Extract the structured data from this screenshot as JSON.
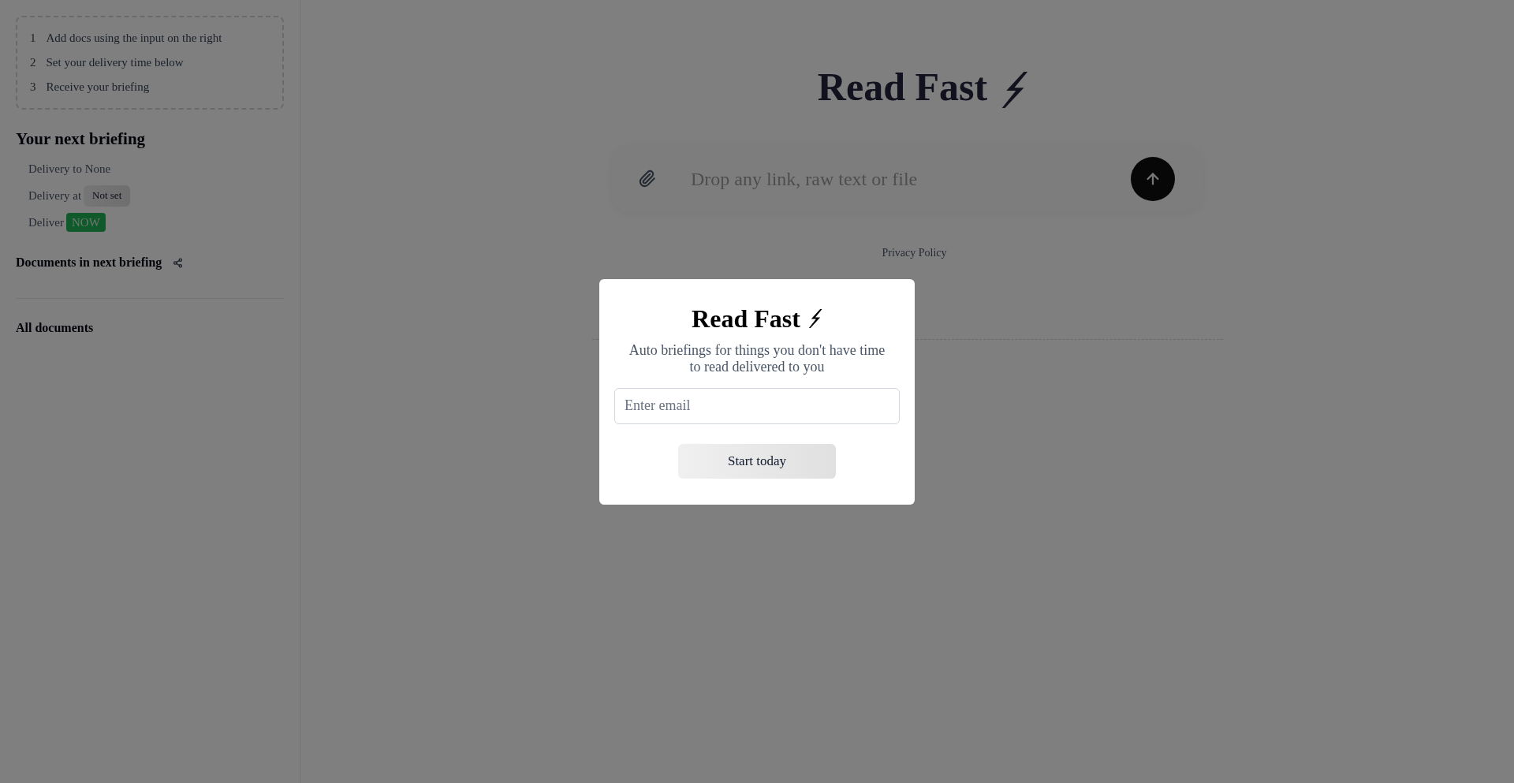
{
  "sidebar": {
    "steps": [
      {
        "number": "1",
        "text": "Add docs using the input on the right"
      },
      {
        "number": "2",
        "text": "Set your delivery time below"
      },
      {
        "number": "3",
        "text": "Receive your briefing"
      }
    ],
    "next_briefing": {
      "title": "Your next briefing",
      "rows": [
        {
          "kind": "text",
          "label": "Delivery to None"
        },
        {
          "kind": "badge",
          "label": "Delivery at",
          "value": "Not set"
        },
        {
          "kind": "action",
          "label": "Deliver",
          "value": "NOW"
        }
      ]
    },
    "documents_in_next_briefing": {
      "title": "Documents in next briefing"
    },
    "all_documents": {
      "title": "All documents"
    }
  },
  "main": {
    "title": "Read Fast",
    "input": {
      "placeholder": "Drop any link, raw text or file"
    },
    "footer_link": "Privacy Policy"
  },
  "modal": {
    "title": "Read Fast",
    "subtitle": "Auto briefings for things you don't have time to read delivered to you",
    "email": {
      "placeholder": "Enter email"
    },
    "button": "Start today"
  }
}
